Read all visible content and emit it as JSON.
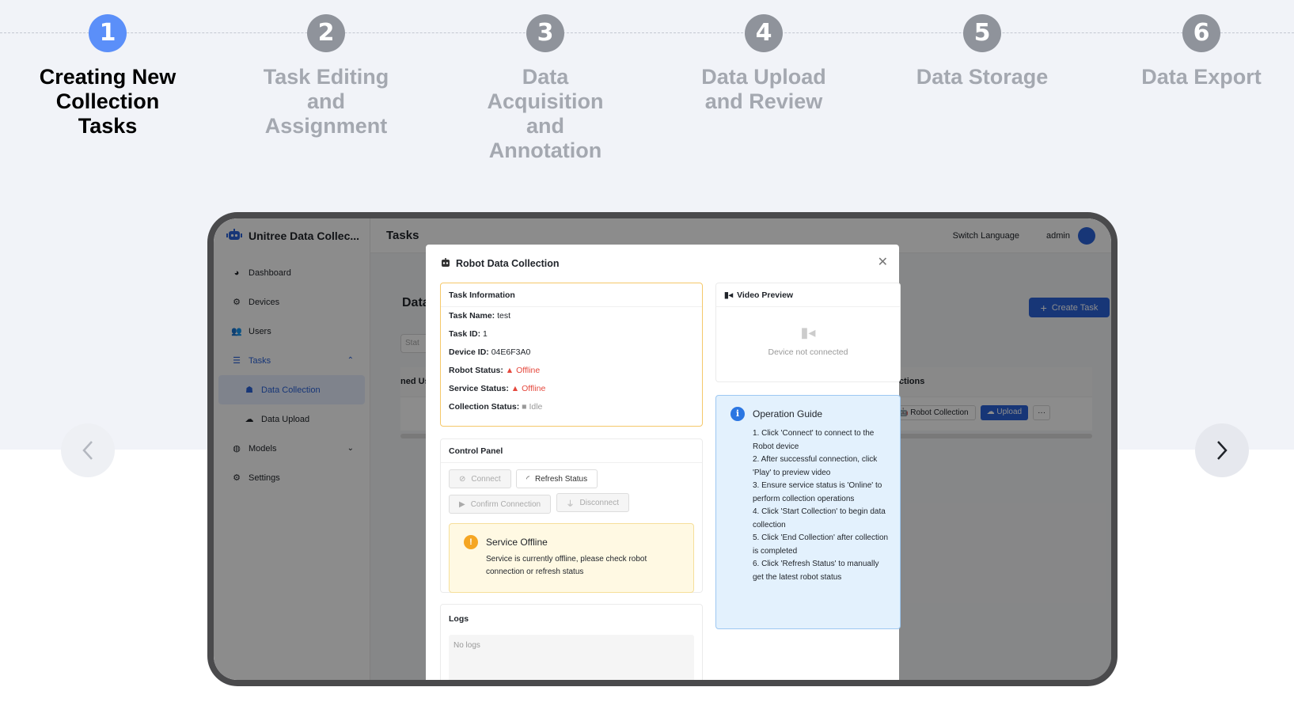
{
  "steps": [
    {
      "num": "1",
      "label": "Creating New Collection Tasks"
    },
    {
      "num": "2",
      "label": "Task Editing and Assignment"
    },
    {
      "num": "3",
      "label": "Data Acquisition and Annotation"
    },
    {
      "num": "4",
      "label": "Data Upload and Review"
    },
    {
      "num": "5",
      "label": "Data Storage"
    },
    {
      "num": "6",
      "label": "Data Export"
    }
  ],
  "app": {
    "brand": "Unitree Data Collec...",
    "page_title": "Tasks",
    "switch_language": "Switch Language",
    "user": "admin",
    "sidebar": {
      "dashboard": "Dashboard",
      "devices": "Devices",
      "users": "Users",
      "tasks": "Tasks",
      "data_collection": "Data Collection",
      "data_upload": "Data Upload",
      "models": "Models",
      "settings": "Settings"
    },
    "page_heading": "Data",
    "filter_placeholder": "Stat",
    "create_task": "Create Task",
    "table": {
      "col_assigned": "ned Us",
      "col_actions": "Actions"
    },
    "row_actions": {
      "robot_collection": "Robot Collection",
      "upload": "Upload",
      "more": "···"
    }
  },
  "modal": {
    "title": "Robot Data Collection",
    "task_info": {
      "header": "Task Information",
      "task_name_label": "Task Name:",
      "task_name": "test",
      "task_id_label": "Task ID:",
      "task_id": "1",
      "device_id_label": "Device ID:",
      "device_id": "04E6F3A0",
      "robot_status_label": "Robot Status:",
      "robot_status": "Offline",
      "service_status_label": "Service Status:",
      "service_status": "Offline",
      "collection_status_label": "Collection Status:",
      "collection_status": "Idle"
    },
    "video": {
      "header": "Video Preview",
      "message": "Device not connected"
    },
    "control": {
      "header": "Control Panel",
      "connect": "Connect",
      "refresh": "Refresh Status",
      "confirm": "Confirm Connection",
      "disconnect": "Disconnect"
    },
    "warning": {
      "title": "Service Offline",
      "message": "Service is currently offline, please check robot connection or refresh status"
    },
    "logs": {
      "header": "Logs",
      "empty": "No logs"
    },
    "guide": {
      "title": "Operation Guide",
      "items": [
        "1. Click 'Connect' to connect to the Robot device",
        "2. After successful connection, click 'Play' to preview video",
        "3. Ensure service status is 'Online' to perform collection operations",
        "4. Click 'Start Collection' to begin data collection",
        "5. Click 'End Collection' after collection is completed",
        "6. Click 'Refresh Status' to manually get the latest robot status"
      ]
    }
  }
}
